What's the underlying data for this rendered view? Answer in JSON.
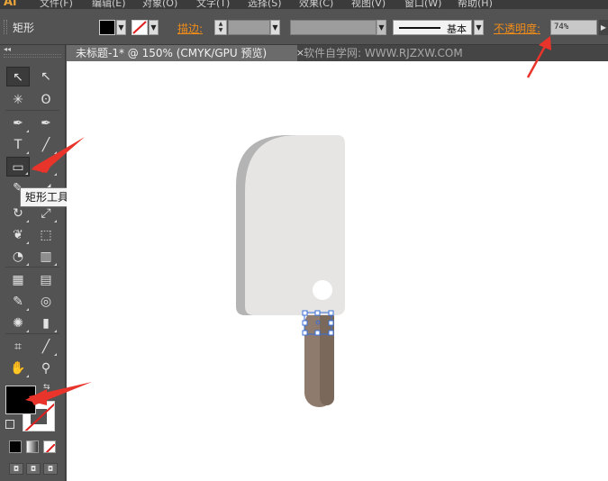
{
  "menubar": {
    "logo": "Ai",
    "items": [
      "文件(F)",
      "编辑(E)",
      "对象(O)",
      "文字(T)",
      "选择(S)",
      "效果(C)",
      "视图(V)",
      "窗口(W)",
      "帮助(H)"
    ]
  },
  "control": {
    "tool_name": "矩形",
    "stroke_label": "描边:",
    "stroke_style": "基本",
    "opacity_label": "不透明度:",
    "opacity_value": "74%"
  },
  "document": {
    "tab_title": "未标题-1* @ 150% (CMYK/GPU 预览)",
    "close": "×",
    "watermark": "软件自学网: WWW.RJZXW.COM"
  },
  "tooltip": "矩形工具 (M)",
  "tools": [
    {
      "name": "selection-tool",
      "glyph": "↖"
    },
    {
      "name": "direct-selection-tool",
      "glyph": "↖"
    },
    {
      "name": "magic-wand-tool",
      "glyph": "✳"
    },
    {
      "name": "lasso-tool",
      "glyph": "ʘ"
    },
    {
      "name": "pen-tool",
      "glyph": "✒"
    },
    {
      "name": "curvature-tool",
      "glyph": "✒"
    },
    {
      "name": "type-tool",
      "glyph": "T"
    },
    {
      "name": "line-tool",
      "glyph": "╱"
    },
    {
      "name": "rectangle-tool",
      "glyph": "▭"
    },
    {
      "name": "paintbrush-tool",
      "glyph": "✐"
    },
    {
      "name": "pencil-tool",
      "glyph": "✎"
    },
    {
      "name": "eraser-tool",
      "glyph": "◢"
    },
    {
      "name": "rotate-tool",
      "glyph": "↻"
    },
    {
      "name": "scale-tool",
      "glyph": "⤢"
    },
    {
      "name": "warp-tool",
      "glyph": "❦"
    },
    {
      "name": "free-transform-tool",
      "glyph": "⬚"
    },
    {
      "name": "shape-builder-tool",
      "glyph": "◔"
    },
    {
      "name": "perspective-grid-tool",
      "glyph": "▥"
    },
    {
      "name": "mesh-tool",
      "glyph": "▦"
    },
    {
      "name": "gradient-tool",
      "glyph": "▤"
    },
    {
      "name": "eyedropper-tool",
      "glyph": "✎"
    },
    {
      "name": "blend-tool",
      "glyph": "◎"
    },
    {
      "name": "symbol-sprayer-tool",
      "glyph": "✺"
    },
    {
      "name": "column-graph-tool",
      "glyph": "▮"
    },
    {
      "name": "artboard-tool",
      "glyph": "⌗"
    },
    {
      "name": "slice-tool",
      "glyph": "╱"
    },
    {
      "name": "hand-tool",
      "glyph": "✋"
    },
    {
      "name": "zoom-tool",
      "glyph": "⚲"
    }
  ],
  "colors": {
    "accent_orange": "#f08c1a",
    "arrow_red": "#e8342a",
    "popsicle_front": "#e6e5e4",
    "popsicle_shadow": "#b4b4b4",
    "stick": "#8f7b6d",
    "selection": "#3a6fd8"
  }
}
